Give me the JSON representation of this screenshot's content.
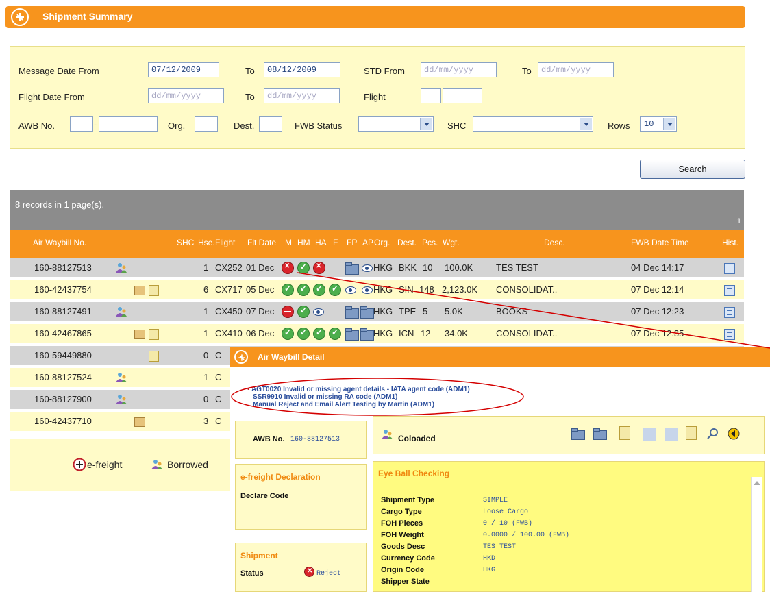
{
  "header": {
    "title": "Shipment Summary"
  },
  "filters": {
    "message_date_from_label": "Message Date From",
    "message_date_from": "07/12/2009",
    "to1_label": "To",
    "message_date_to": "08/12/2009",
    "std_from_label": "STD From",
    "std_from_ph": "dd/mm/yyyy",
    "to2_label": "To",
    "std_to_ph": "dd/mm/yyyy",
    "flight_date_from_label": "Flight Date From",
    "flight_date_from_ph": "dd/mm/yyyy",
    "to3_label": "To",
    "flight_date_to_ph": "dd/mm/yyyy",
    "flight_label": "Flight",
    "awb_label": "AWB No.",
    "org_label": "Org.",
    "dest_label": "Dest.",
    "fwb_status_label": "FWB Status",
    "shc_label": "SHC",
    "rows_label": "Rows",
    "rows_value": "10",
    "search_label": "Search"
  },
  "results": {
    "summary": "8 records in 1 page(s).",
    "page": "1",
    "columns": {
      "awb": "Air Waybill No.",
      "shc": "SHC",
      "hse": "Hse.",
      "flight": "Flight",
      "fltdate": "Flt Date",
      "m": "M",
      "hm": "HM",
      "ha": "HA",
      "f": "F",
      "fp": "FP",
      "ap": "AP",
      "org": "Org.",
      "dest": "Dest.",
      "pcs": "Pcs.",
      "wgt": "Wgt.",
      "desc": "Desc.",
      "fwb": "FWB Date Time",
      "hist": "Hist."
    },
    "rows": [
      {
        "awb": "160-88127513",
        "hse": "1",
        "flight": "CX252",
        "date": "01 Dec",
        "org": "HKG",
        "dest": "BKK",
        "pcs": "10",
        "wgt": "100.0K",
        "desc": "TES TEST",
        "fwb": "04 Dec 14:17"
      },
      {
        "awb": "160-42437754",
        "hse": "6",
        "flight": "CX717",
        "date": "05 Dec",
        "org": "HKG",
        "dest": "SIN",
        "pcs": "148",
        "wgt": "2,123.0K",
        "desc": "CONSOLIDAT..",
        "fwb": "07 Dec 12:14"
      },
      {
        "awb": "160-88127491",
        "hse": "1",
        "flight": "CX450",
        "date": "07 Dec",
        "org": "HKG",
        "dest": "TPE",
        "pcs": "5",
        "wgt": "5.0K",
        "desc": "BOOKS",
        "fwb": "07 Dec 12:23"
      },
      {
        "awb": "160-42467865",
        "hse": "1",
        "flight": "CX410",
        "date": "06 Dec",
        "org": "HKG",
        "dest": "ICN",
        "pcs": "12",
        "wgt": "34.0K",
        "desc": "CONSOLIDAT..",
        "fwb": "07 Dec 12:35"
      },
      {
        "awb": "160-59449880",
        "hse": "0",
        "flight": "C"
      },
      {
        "awb": "160-88127524",
        "hse": "1",
        "flight": "C"
      },
      {
        "awb": "160-88127900",
        "hse": "0",
        "flight": "C"
      },
      {
        "awb": "160-42437710",
        "hse": "3",
        "flight": "C"
      }
    ]
  },
  "legend": {
    "efreight": "e-freight",
    "borrowed": "Borrowed"
  },
  "detail": {
    "title": "Air Waybill Detail",
    "errors": [
      "AGT0020 Invalid or missing agent details - IATA agent code (ADM1)",
      "SSR9910 Invalid or missing RA code (ADM1)",
      "Manual Reject and Email Alert Testing by Martin (ADM1)"
    ],
    "awb_label": "AWB No.",
    "awb_value": "160-88127513",
    "coloaded": "Coloaded",
    "efreight_title": "e-freight Declaration",
    "declare_code": "Declare Code",
    "eyeball_title": "Eye Ball Checking",
    "fields": [
      {
        "k": "Shipment Type",
        "v": "SIMPLE"
      },
      {
        "k": "Cargo Type",
        "v": "Loose Cargo"
      },
      {
        "k": "FOH Pieces",
        "v": "0 / 10 (FWB)"
      },
      {
        "k": "FOH Weight",
        "v": "0.0000 / 100.00 (FWB)"
      },
      {
        "k": "Goods Desc",
        "v": "TES TEST"
      },
      {
        "k": "Currency Code",
        "v": "HKD"
      },
      {
        "k": "Origin Code",
        "v": "HKG"
      },
      {
        "k": "Shipper State",
        "v": ""
      }
    ],
    "shipment_title": "Shipment",
    "status_label": "Status",
    "status_value": "Reject"
  },
  "colors": {
    "orange": "#f7941d",
    "yellow": "#fffbc8",
    "gray": "#8c8c8c",
    "annotation_red": "#d40000"
  }
}
